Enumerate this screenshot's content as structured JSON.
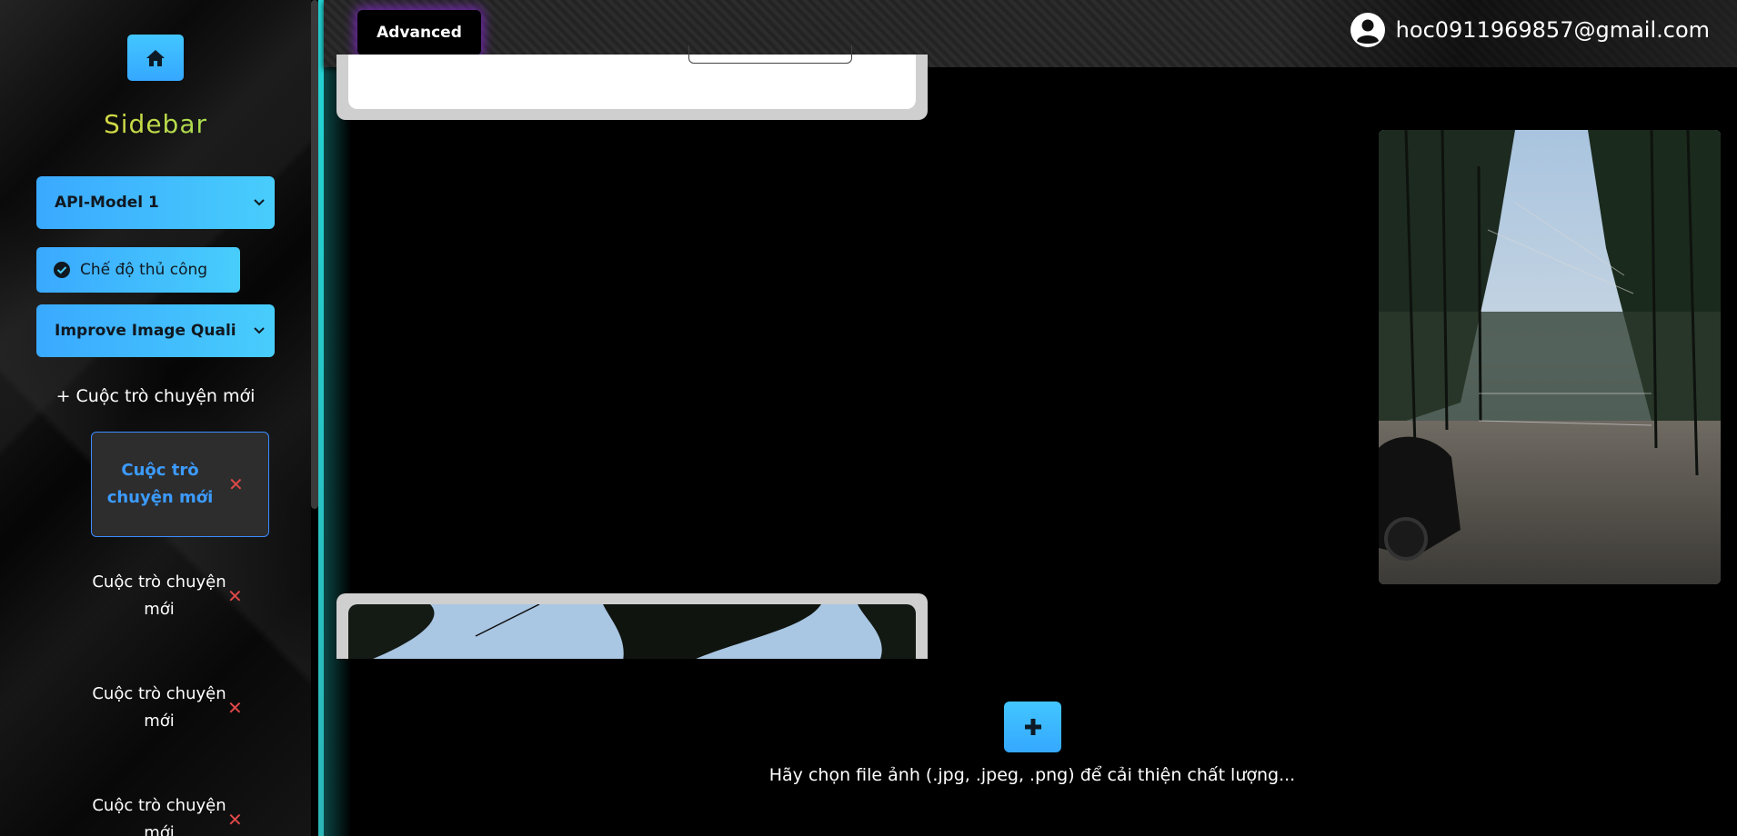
{
  "header": {
    "advanced_label": "Advanced",
    "user_email": "hoc0911969857@gmail.com"
  },
  "sidebar": {
    "title": "Sidebar",
    "model_select": {
      "value": "API-Model 1"
    },
    "manual_mode_label": "Chế độ thủ công",
    "task_select": {
      "value": "Improve Image Quali"
    },
    "new_chat_label": "+ Cuộc trò chuyện mới",
    "chats": [
      {
        "label": "Cuộc trò chuyện mới",
        "active": true
      },
      {
        "label": "Cuộc trò chuyện mới",
        "active": false
      },
      {
        "label": "Cuộc trò chuyện mới",
        "active": false
      },
      {
        "label": "Cuộc trò chuyện mới",
        "active": false
      }
    ],
    "delete_glyph": "✕"
  },
  "upload": {
    "hint": "Hãy chọn file ảnh (.jpg, .jpeg, .png) để cải thiện chất lượng..."
  },
  "colors": {
    "accent": "#3aa9ff",
    "divider": "#23d4d4",
    "advanced_glow": "#8c28dc",
    "delete": "#e04848"
  },
  "icons": {
    "home": "home-icon",
    "check": "check-circle-icon",
    "chevron": "chevron-down-icon",
    "user": "user-circle-icon",
    "plus": "plus-icon"
  }
}
